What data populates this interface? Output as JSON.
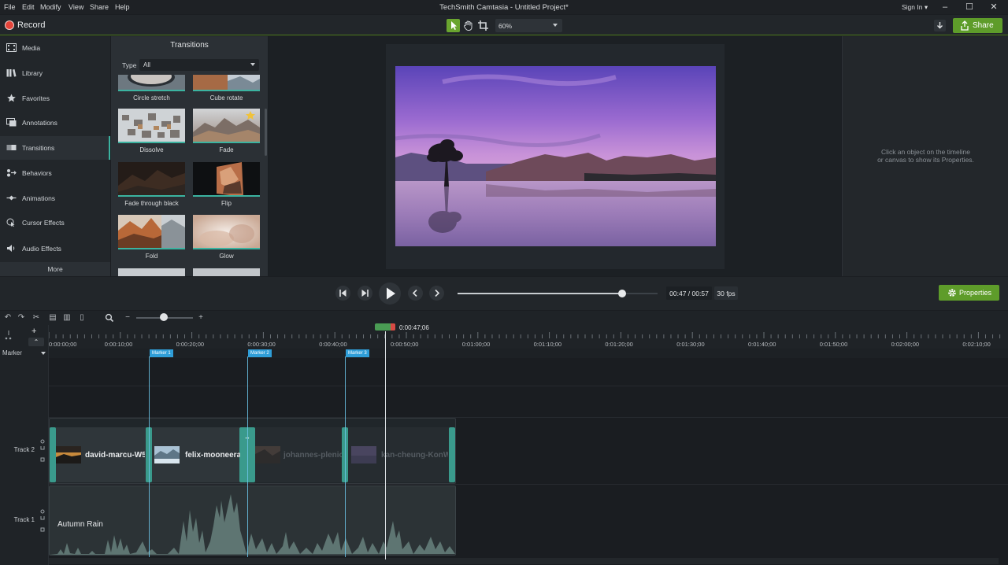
{
  "menu": {
    "items": [
      "File",
      "Edit",
      "Modify",
      "View",
      "Share",
      "Help"
    ],
    "app_title": "TechSmith Camtasia - Untitled Project*",
    "sign_in": "Sign In ▾"
  },
  "toolbar": {
    "record_label": "Record",
    "zoom_value": "60%",
    "share_label": "Share"
  },
  "left_nav": {
    "items": [
      {
        "label": "Media",
        "icon": "film-icon"
      },
      {
        "label": "Library",
        "icon": "library-icon"
      },
      {
        "label": "Favorites",
        "icon": "star-icon"
      },
      {
        "label": "Annotations",
        "icon": "annotation-icon"
      },
      {
        "label": "Transitions",
        "icon": "transition-icon"
      },
      {
        "label": "Behaviors",
        "icon": "behavior-icon"
      },
      {
        "label": "Animations",
        "icon": "animation-icon"
      },
      {
        "label": "Cursor Effects",
        "icon": "cursor-icon"
      },
      {
        "label": "Audio Effects",
        "icon": "audio-icon"
      }
    ],
    "active": "Transitions",
    "more_label": "More"
  },
  "transitions": {
    "title": "Transitions",
    "type_label": "Type",
    "type_value": "All",
    "tiles": [
      {
        "label": "Circle stretch"
      },
      {
        "label": "Cube rotate"
      },
      {
        "label": "Dissolve"
      },
      {
        "label": "Fade",
        "favorite": true
      },
      {
        "label": "Fade through black"
      },
      {
        "label": "Flip"
      },
      {
        "label": "Fold"
      },
      {
        "label": "Glow"
      }
    ]
  },
  "properties_pane": {
    "hint_line1": "Click an object on the timeline",
    "hint_line2": "or canvas to show its Properties."
  },
  "playback": {
    "time": "00:47 / 00:57",
    "fps": "30 fps",
    "progress": 0.8246,
    "properties_label": "Properties"
  },
  "timeline": {
    "playhead_time": "0:00:47;06",
    "ruler_labels": [
      "0:00:00;00",
      "0:00:10;00",
      "0:00:20;00",
      "0:00:30;00",
      "0:00:40;00",
      "0:00:50;00",
      "0:01:00;00",
      "0:01:10;00",
      "0:01:20;00",
      "0:01:30;00",
      "0:01:40;00",
      "0:01:50;00",
      "0:02:00;00",
      "0:02:10;00"
    ],
    "marker_header": "Marker",
    "markers": [
      "Marker 1",
      "Marker 2",
      "Marker 3"
    ],
    "tracks": [
      {
        "label": "Track 2",
        "clips": [
          "david-marcu-W5",
          "felix-mooneeram",
          "johannes-plenio",
          "kan-cheung-KonW"
        ]
      },
      {
        "label": "Track 1",
        "clips": [
          "Autumn Rain"
        ]
      }
    ]
  },
  "colors": {
    "accent_green": "#5e9c2a",
    "teal": "#3bb3a0",
    "marker_blue": "#2f9ed8",
    "record_red": "#e4443a"
  }
}
